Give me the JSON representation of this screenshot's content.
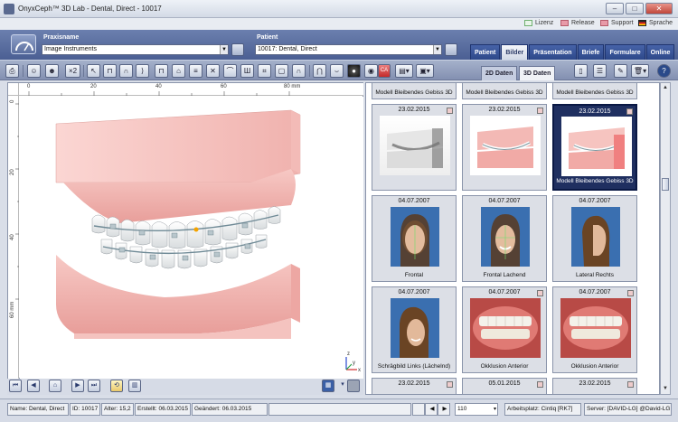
{
  "window": {
    "title": "OnyxCeph™ 3D Lab - Dental, Direct - 10017",
    "controls": [
      "–",
      "□",
      "✕"
    ]
  },
  "legend": [
    {
      "label": "Lizenz",
      "color": "#e9f4e9",
      "border": "#6fb06f"
    },
    {
      "label": "Release",
      "color": "#e89aa8",
      "border": "#b65a6a"
    },
    {
      "label": "Support",
      "color": "#e89aa8",
      "border": "#b65a6a"
    },
    {
      "label": "Sprache",
      "color": "#d23",
      "border": "#222"
    }
  ],
  "header": {
    "praxis_label": "Praxisname",
    "praxis_value": "Image Instruments",
    "patient_label": "Patient",
    "patient_value": "10017: Dental, Direct",
    "tabs": [
      {
        "label": "Patient",
        "active": false
      },
      {
        "label": "Bilder",
        "active": true
      },
      {
        "label": "Präsentation",
        "active": false
      },
      {
        "label": "Briefe",
        "active": false
      },
      {
        "label": "Formulare",
        "active": false
      },
      {
        "label": "Online",
        "active": false
      }
    ]
  },
  "toolbar": {
    "icons": [
      "print-icon",
      "person-icon",
      "person-group-icon",
      "x2-icon",
      "cursor-icon",
      "teeth-pair-icon",
      "tooth-pair-icon",
      "arch-icon",
      "bracket-icon",
      "tooth-icon",
      "bite-icon",
      "cross-icon",
      "arch-alt-icon",
      "dentition-icon",
      "shape-icon",
      "frame-icon",
      "arch-outline-icon",
      "jaw-icon",
      "arc-icon",
      "circle-dark-icon",
      "ball-icon",
      "ca-icon",
      "window-icon",
      "photo-icon"
    ],
    "view_tabs": [
      {
        "label": "2D Daten",
        "active": false
      },
      {
        "label": "3D Daten",
        "active": true
      }
    ],
    "right_icons": [
      "page-icon",
      "list-icon",
      "edit-icon",
      "trash-icon",
      "help-icon"
    ]
  },
  "viewer": {
    "ruler_x": [
      "0",
      "20",
      "40",
      "60",
      "80 mm"
    ],
    "ruler_y": [
      "0",
      "20",
      "40",
      "60 mm"
    ],
    "axis_labels": {
      "z": "z",
      "y": "y",
      "x": "x"
    }
  },
  "viewer_toolbar": {
    "buttons": [
      "first-icon",
      "prev-icon",
      "home-icon",
      "next-icon",
      "last-icon",
      "settings-icon",
      "film-icon"
    ]
  },
  "gallery": {
    "top_captions": [
      "Modell Bleibendes Gebiss 3D",
      "Modell Bleibendes Gebiss 3D",
      "Modell Bleibendes Gebiss 3D"
    ],
    "cards": [
      {
        "date": "23.02.2015",
        "caption": "",
        "kind": "model",
        "selected": false
      },
      {
        "date": "23.02.2015",
        "caption": "",
        "kind": "model",
        "selected": false
      },
      {
        "date": "23.02.2015",
        "caption": "Modell Bleibendes Gebiss 3D",
        "kind": "model",
        "selected": true
      },
      {
        "date": "04.07.2007",
        "caption": "Frontal",
        "kind": "face",
        "selected": false
      },
      {
        "date": "04.07.2007",
        "caption": "Frontal Lachend",
        "kind": "face",
        "selected": false
      },
      {
        "date": "04.07.2007",
        "caption": "Lateral Rechts",
        "kind": "profile",
        "selected": false
      },
      {
        "date": "04.07.2007",
        "caption": "Schrägbild Links (Lächelnd)",
        "kind": "profile",
        "selected": false
      },
      {
        "date": "04.07.2007",
        "caption": "Okklusion Anterior",
        "kind": "intraoral",
        "selected": false
      },
      {
        "date": "04.07.2007",
        "caption": "Okklusion Anterior",
        "kind": "intraoral",
        "selected": false
      }
    ],
    "bottom_dates": [
      "23.02.2015",
      "05.01.2015",
      "23.02.2015"
    ]
  },
  "status": {
    "name": "Name: Dental, Direct",
    "id": "ID: 10017",
    "age": "Alter: 15,2",
    "created": "Erstellt: 06.03.2015",
    "changed": "Geändert: 06.03.2015",
    "zoom": "110",
    "workstation": "Arbeitsplatz: Cintiq [RK7]",
    "server": "Server: [DAVID-LG] @David-LG"
  }
}
